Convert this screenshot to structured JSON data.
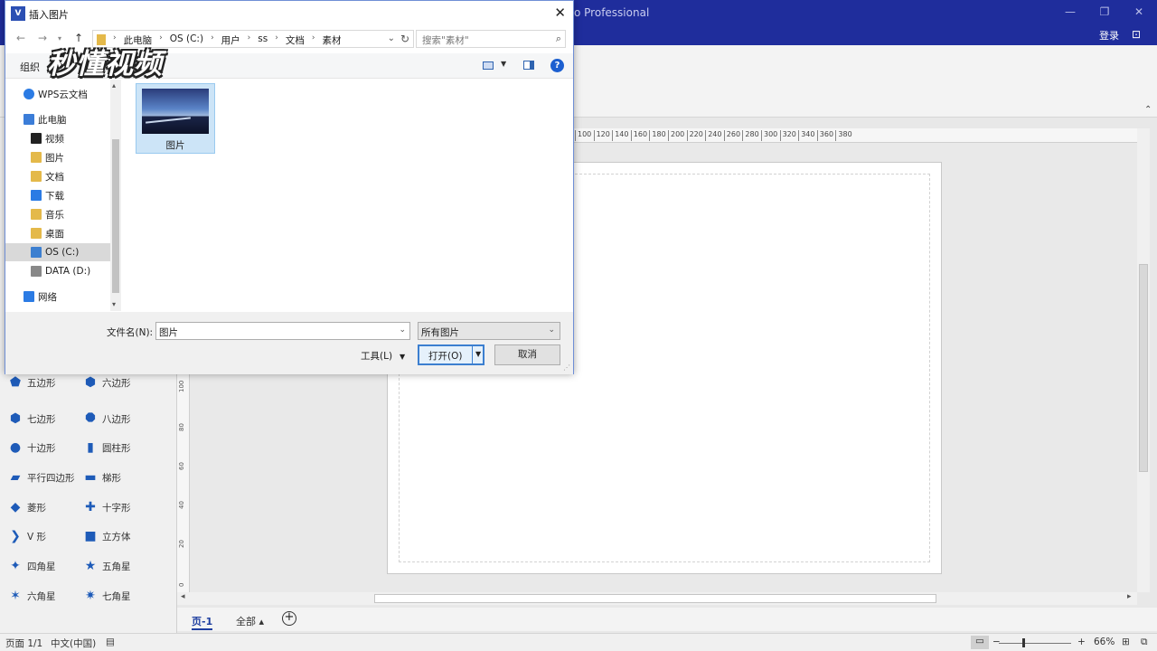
{
  "visio": {
    "title_fragment": "o Professional",
    "login_label": "登录",
    "hruler_ticks": [
      "100",
      "120",
      "140",
      "160",
      "180",
      "200",
      "220",
      "240",
      "260",
      "280",
      "300",
      "320",
      "340",
      "360",
      "380"
    ],
    "vruler_ticks": [
      "100",
      "80",
      "60",
      "40",
      "20",
      "0"
    ],
    "shapes": [
      {
        "label": "五边形",
        "icon": "pentagon-icon"
      },
      {
        "label": "六边形",
        "icon": "hexagon-icon"
      },
      {
        "label": "七边形",
        "icon": "heptagon-icon"
      },
      {
        "label": "八边形",
        "icon": "octagon-icon"
      },
      {
        "label": "十边形",
        "icon": "decagon-icon"
      },
      {
        "label": "圆柱形",
        "icon": "cylinder-icon"
      },
      {
        "label": "平行四边形",
        "icon": "parallelogram-icon"
      },
      {
        "label": "梯形",
        "icon": "trapezoid-icon"
      },
      {
        "label": "菱形",
        "icon": "diamond-icon"
      },
      {
        "label": "十字形",
        "icon": "cross-icon"
      },
      {
        "label": "V 形",
        "icon": "chevron-shape-icon"
      },
      {
        "label": "立方体",
        "icon": "cube-icon"
      },
      {
        "label": "四角星",
        "icon": "star4-icon"
      },
      {
        "label": "五角星",
        "icon": "star5-icon"
      },
      {
        "label": "六角星",
        "icon": "star6-icon"
      },
      {
        "label": "七角星",
        "icon": "star7-icon"
      }
    ],
    "page_tab": "页-1",
    "all_pages_tab": "全部",
    "status": {
      "page": "页面 1/1",
      "language": "中文(中国)",
      "zoom": "66%"
    },
    "accent_color": "#1f2d9c"
  },
  "dialog": {
    "title": "插入图片",
    "breadcrumbs": [
      "此电脑",
      "OS (C:)",
      "用户",
      "ss",
      "文档",
      "素材"
    ],
    "search_placeholder": "搜索\"素材\"",
    "organize_label": "组织",
    "watermark": "秒懂视频",
    "nav_items": [
      {
        "label": "WPS云文档",
        "icon": "cloud-icon"
      },
      {
        "label": "此电脑",
        "icon": "computer-icon"
      },
      {
        "label": "视频",
        "icon": "video-folder-icon"
      },
      {
        "label": "图片",
        "icon": "pictures-folder-icon"
      },
      {
        "label": "文档",
        "icon": "documents-folder-icon"
      },
      {
        "label": "下载",
        "icon": "downloads-folder-icon"
      },
      {
        "label": "音乐",
        "icon": "music-folder-icon"
      },
      {
        "label": "桌面",
        "icon": "desktop-folder-icon"
      },
      {
        "label": "OS (C:)",
        "icon": "drive-c-icon"
      },
      {
        "label": "DATA (D:)",
        "icon": "drive-d-icon"
      },
      {
        "label": "网络",
        "icon": "network-icon"
      }
    ],
    "selected_nav": "OS (C:)",
    "file": {
      "name": "图片"
    },
    "filename_label": "文件名(N):",
    "filename_value": "图片",
    "filetype_value": "所有图片",
    "tools_label": "工具(L)",
    "open_label": "打开(O)",
    "cancel_label": "取消"
  }
}
